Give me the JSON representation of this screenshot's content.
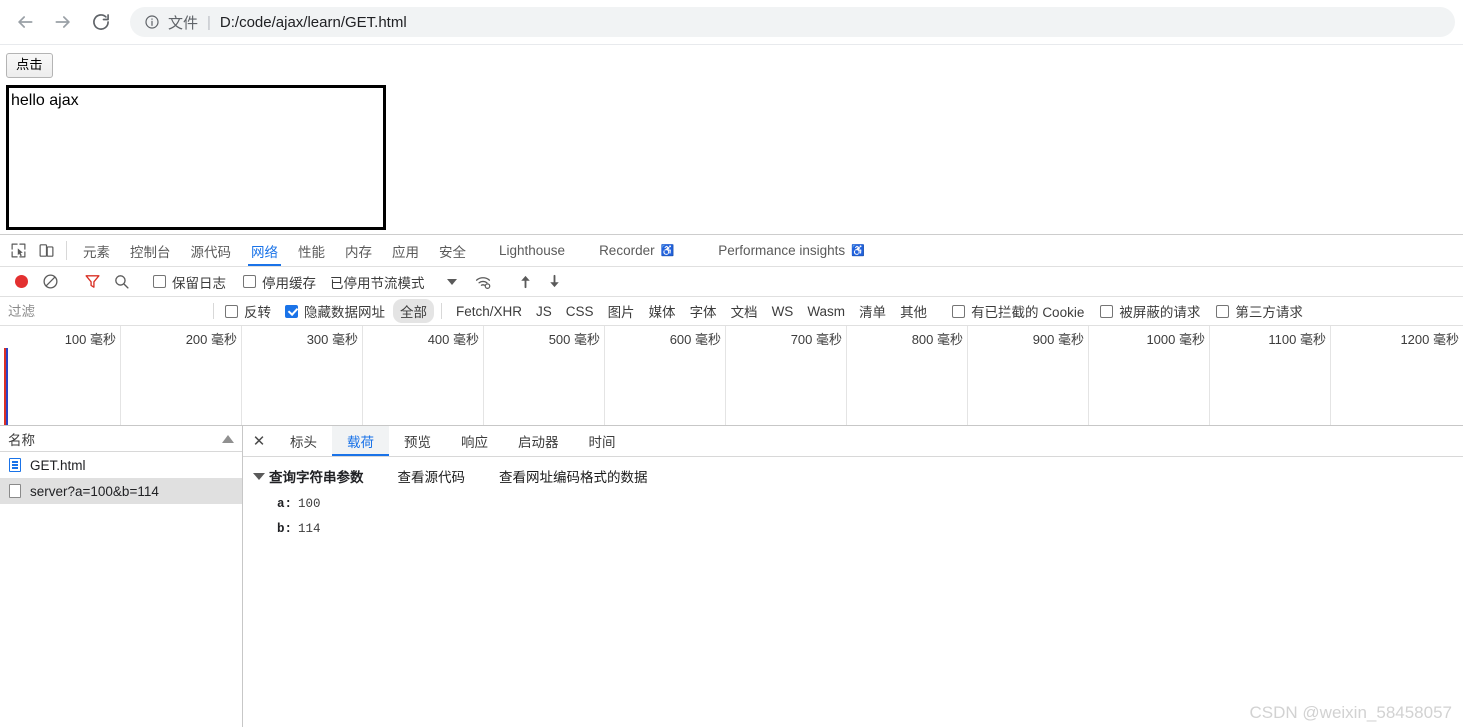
{
  "browser": {
    "back_icon": "arrow-left-icon",
    "forward_icon": "arrow-right-icon",
    "reload_icon": "reload-icon",
    "omnibox": {
      "info_icon": "info-circle-icon",
      "scheme_label": "文件",
      "separator": "|",
      "url": "D:/code/ajax/learn/GET.html"
    }
  },
  "page": {
    "button_label": "点击",
    "result_text": "hello ajax"
  },
  "devtools": {
    "left_icons": [
      {
        "name": "inspect-element-icon"
      },
      {
        "name": "device-toolbar-icon"
      }
    ],
    "tabs": [
      {
        "label": "元素",
        "active": false,
        "cjk": true
      },
      {
        "label": "控制台",
        "active": false,
        "cjk": true
      },
      {
        "label": "源代码",
        "active": false,
        "cjk": true
      },
      {
        "label": "网络",
        "active": true,
        "cjk": true
      },
      {
        "label": "性能",
        "active": false,
        "cjk": true
      },
      {
        "label": "内存",
        "active": false,
        "cjk": true
      },
      {
        "label": "应用",
        "active": false,
        "cjk": true
      },
      {
        "label": "安全",
        "active": false,
        "cjk": true
      },
      {
        "label": "Lighthouse",
        "active": false,
        "cjk": false
      },
      {
        "label": "Recorder",
        "active": false,
        "cjk": false,
        "experiment": true
      },
      {
        "label": "Performance insights",
        "active": false,
        "cjk": false,
        "experiment": true
      }
    ],
    "network_toolbar": {
      "record_icon": "record-dot-icon",
      "clear_icon": "clear-no-entry-icon",
      "filter_icon": "filter-funnel-icon",
      "search_icon": "search-icon",
      "preserve_log": {
        "label": "保留日志",
        "checked": false
      },
      "disable_cache": {
        "label": "停用缓存",
        "checked": false
      },
      "throttling": {
        "label": "已停用节流模式",
        "chevron_icon": "chevron-down-icon"
      },
      "network_conditions_icon": "wifi-settings-icon",
      "import_icon": "upload-arrow-icon",
      "export_icon": "download-arrow-icon"
    },
    "filter_bar": {
      "filter_placeholder": "过滤",
      "filter_value": "",
      "invert": {
        "label": "反转",
        "checked": false
      },
      "hide_data_urls": {
        "label": "隐藏数据网址",
        "checked": true
      },
      "types": [
        {
          "label": "全部",
          "selected": true
        },
        {
          "label": "Fetch/XHR",
          "selected": false
        },
        {
          "label": "JS",
          "selected": false
        },
        {
          "label": "CSS",
          "selected": false
        },
        {
          "label": "图片",
          "selected": false
        },
        {
          "label": "媒体",
          "selected": false
        },
        {
          "label": "字体",
          "selected": false
        },
        {
          "label": "文档",
          "selected": false
        },
        {
          "label": "WS",
          "selected": false
        },
        {
          "label": "Wasm",
          "selected": false
        },
        {
          "label": "清单",
          "selected": false
        },
        {
          "label": "其他",
          "selected": false
        }
      ],
      "blocked_cookies": {
        "label": "有已拦截的 Cookie",
        "checked": false
      },
      "blocked_requests": {
        "label": "被屏蔽的请求",
        "checked": false
      },
      "third_party": {
        "label": "第三方请求",
        "checked": false
      }
    },
    "overview": {
      "ticks": [
        "100 毫秒",
        "200 毫秒",
        "300 毫秒",
        "400 毫秒",
        "500 毫秒",
        "600 毫秒",
        "700 毫秒",
        "800 毫秒",
        "900 毫秒",
        "1000 毫秒",
        "1100 毫秒",
        "1200 毫秒"
      ],
      "marker_red_color": "#d93025",
      "marker_blue_color": "#2b42c4"
    },
    "requests": {
      "column_header": "名称",
      "sort_icon": "sort-ascending-arrow-icon",
      "rows": [
        {
          "name": "GET.html",
          "icon": "document-icon",
          "selected": false
        },
        {
          "name": "server?a=100&b=114",
          "icon": "generic-file-icon",
          "selected": true
        }
      ]
    },
    "detail": {
      "close_icon": "close-icon",
      "tabs": [
        {
          "label": "标头",
          "active": false
        },
        {
          "label": "载荷",
          "active": true
        },
        {
          "label": "预览",
          "active": false
        },
        {
          "label": "响应",
          "active": false
        },
        {
          "label": "启动器",
          "active": false
        },
        {
          "label": "时间",
          "active": false
        }
      ],
      "payload": {
        "section_title": "查询字符串参数",
        "disclosure_icon": "triangle-down-icon",
        "view_source_label": "查看源代码",
        "view_urlencoded_label": "查看网址编码格式的数据",
        "params": [
          {
            "key": "a:",
            "value": "100"
          },
          {
            "key": "b:",
            "value": "114"
          }
        ]
      }
    }
  },
  "watermark": "CSDN @weixin_58458057"
}
